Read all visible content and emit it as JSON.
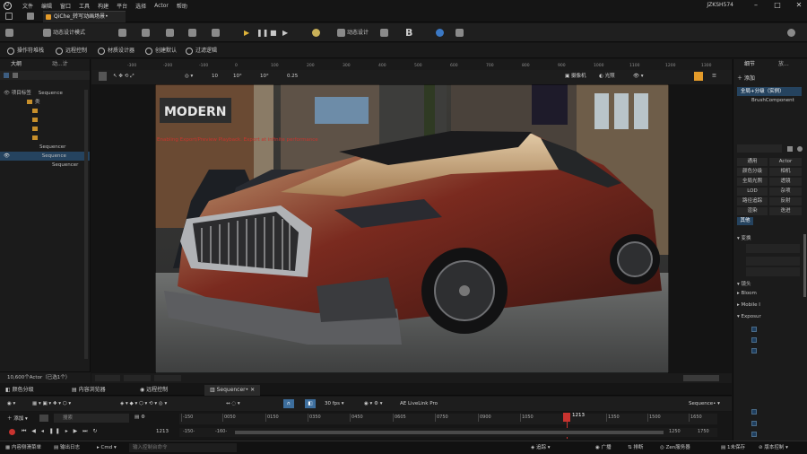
{
  "menubar": {
    "items": [
      "文件",
      "编辑",
      "窗口",
      "工具",
      "构建",
      "平台",
      "选择",
      "Actor",
      "帮助"
    ],
    "user": "JZKSH574"
  },
  "tab": {
    "label": "QiChe_转写动画场景•"
  },
  "toolbar": {
    "mode": "动态设计模式",
    "mode2": "动态设计",
    "brand": "B"
  },
  "secondary": {
    "items": [
      "操作符堆栈",
      "远程控制",
      "材质设计器",
      "创建默认",
      "过滤逻辑"
    ]
  },
  "outliner": {
    "tab1": "大纲",
    "tab2": "动...计",
    "rows": [
      "项目标签",
      "Sequence",
      "类",
      "Sequencer",
      "Sequence",
      "Sequencer"
    ]
  },
  "actorcount": "10,600个Actor（已选1个）",
  "viewport": {
    "left_label": "视口",
    "perspective": "摄像机",
    "lit": "光照",
    "zoom": "0.25",
    "angle": "10°",
    "grid": "10",
    "scale": "10°",
    "notice": "Enabling Export/Preview Playback. Export at infinite performance",
    "ruler": [
      "-300",
      "-200",
      "-100",
      "0",
      "100",
      "200",
      "300",
      "400",
      "500",
      "600",
      "700",
      "800",
      "900",
      "1000",
      "1100",
      "1200",
      "1300"
    ]
  },
  "details": {
    "tab1": "细节",
    "tab2": "放...",
    "add": "添加",
    "filter": "全局+分级（实例）",
    "component": "BrushComponent",
    "categories": [
      "通用",
      "Actor",
      "颜色分级",
      "相机",
      "全局光照",
      "透镜",
      "LOD",
      "杂项",
      "路径追踪",
      "反射",
      "渲染",
      "迭进",
      "其他"
    ],
    "sections": [
      "变换",
      "镜头",
      "Bloom",
      "Mobile I",
      "Exposur"
    ]
  },
  "bottomtabs": {
    "items": [
      "颜色分级",
      "内容浏览器",
      "远程控制",
      "Sequencer•"
    ]
  },
  "sequencer": {
    "fps": "30 fps",
    "livelink": "AE LiveLink Pro",
    "add": "添加",
    "search": "搜索",
    "frame": "1213",
    "name": "Sequence•",
    "start": "-150",
    "range_start": "-150-",
    "range_end": "1250",
    "end": "1750",
    "ticks": [
      "-150",
      "0050",
      "0150",
      "0350",
      "0450",
      "0605",
      "0750",
      "0900",
      "1050",
      "1213",
      "1350",
      "1500",
      "1650"
    ]
  },
  "statusbar": {
    "items": [
      "内容侧滑菜单",
      "输出日志",
      "Cmd",
      "输入控制台命令",
      "追踪",
      "广播",
      "排断",
      "Zen服务器",
      "1未保存",
      "版本控制"
    ]
  },
  "colors": {
    "accent": "#e49b2a",
    "select": "#25435f",
    "bg": "#151515"
  }
}
